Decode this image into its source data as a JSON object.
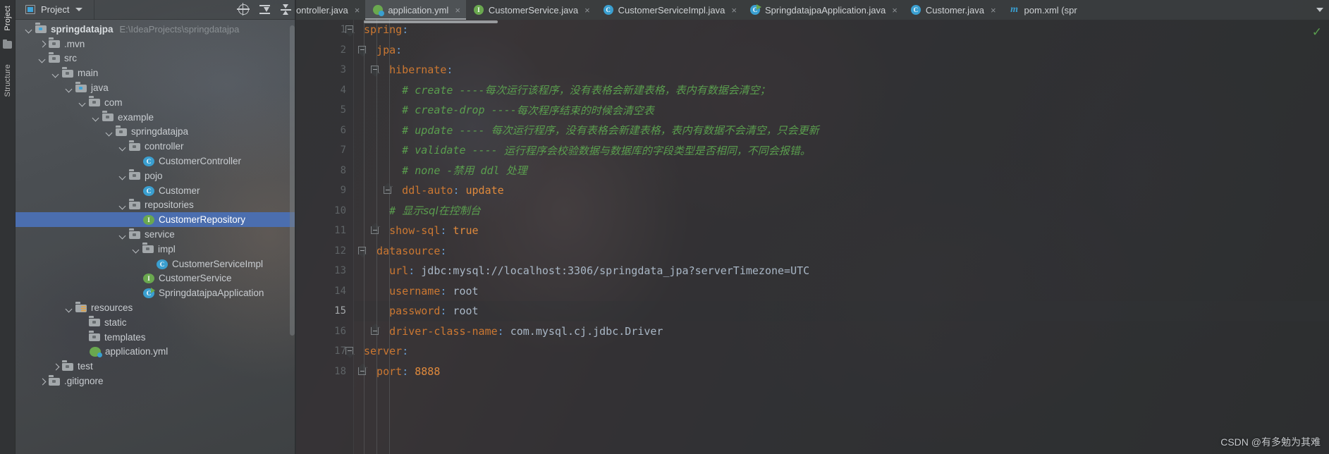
{
  "tool_strip": {
    "tabs": [
      {
        "label": "Project",
        "active": true
      },
      {
        "label": "Structure",
        "active": false
      }
    ],
    "folder_icon": "folder-icon"
  },
  "project_panel": {
    "header": {
      "icon": "project-view-icon",
      "title": "Project",
      "caret": "chevron-down-icon",
      "actions": [
        {
          "name": "locate-in-tree",
          "icon": "crosshair-icon"
        },
        {
          "name": "expand-all",
          "icon": "expand-all-icon"
        },
        {
          "name": "collapse-all",
          "icon": "collapse-all-icon"
        }
      ]
    },
    "tree": [
      {
        "indent": 0,
        "chevron": "down",
        "icon": "module-folder",
        "label": "springdatajpa",
        "bold": true,
        "path": "E:\\IdeaProjects\\springdatajpa",
        "selected": false
      },
      {
        "indent": 1,
        "chevron": "right",
        "icon": "folder",
        "label": ".mvn",
        "selected": false
      },
      {
        "indent": 1,
        "chevron": "down",
        "icon": "folder",
        "label": "src",
        "selected": false
      },
      {
        "indent": 2,
        "chevron": "down",
        "icon": "folder",
        "label": "main",
        "selected": false
      },
      {
        "indent": 3,
        "chevron": "down",
        "icon": "source-folder",
        "label": "java",
        "selected": false
      },
      {
        "indent": 4,
        "chevron": "down",
        "icon": "package",
        "label": "com",
        "selected": false
      },
      {
        "indent": 5,
        "chevron": "down",
        "icon": "package",
        "label": "example",
        "selected": false
      },
      {
        "indent": 6,
        "chevron": "down",
        "icon": "package",
        "label": "springdatajpa",
        "selected": false
      },
      {
        "indent": 7,
        "chevron": "down",
        "icon": "package",
        "label": "controller",
        "selected": false
      },
      {
        "indent": 8,
        "chevron": "none",
        "icon": "class",
        "label": "CustomerController",
        "selected": false
      },
      {
        "indent": 7,
        "chevron": "down",
        "icon": "package",
        "label": "pojo",
        "selected": false
      },
      {
        "indent": 8,
        "chevron": "none",
        "icon": "class",
        "label": "Customer",
        "selected": false
      },
      {
        "indent": 7,
        "chevron": "down",
        "icon": "package",
        "label": "repositories",
        "selected": false
      },
      {
        "indent": 8,
        "chevron": "none",
        "icon": "interface",
        "label": "CustomerRepository",
        "selected": true
      },
      {
        "indent": 7,
        "chevron": "down",
        "icon": "package",
        "label": "service",
        "selected": false
      },
      {
        "indent": 8,
        "chevron": "down",
        "icon": "package",
        "label": "impl",
        "selected": false
      },
      {
        "indent": 9,
        "chevron": "none",
        "icon": "class",
        "label": "CustomerServiceImpl",
        "selected": false
      },
      {
        "indent": 8,
        "chevron": "none",
        "icon": "interface",
        "label": "CustomerService",
        "selected": false
      },
      {
        "indent": 8,
        "chevron": "none",
        "icon": "spring-boot",
        "label": "SpringdatajpaApplication",
        "selected": false
      },
      {
        "indent": 3,
        "chevron": "down",
        "icon": "resource-folder",
        "label": "resources",
        "selected": false
      },
      {
        "indent": 4,
        "chevron": "none",
        "icon": "folder",
        "label": "static",
        "selected": false
      },
      {
        "indent": 4,
        "chevron": "none",
        "icon": "folder",
        "label": "templates",
        "selected": false
      },
      {
        "indent": 4,
        "chevron": "none",
        "icon": "yml-file",
        "label": "application.yml",
        "selected": false
      },
      {
        "indent": 2,
        "chevron": "right",
        "icon": "folder",
        "label": "test",
        "selected": false
      },
      {
        "indent": 1,
        "chevron": "right",
        "icon": "folder",
        "label": ".gitignore",
        "selected": false
      }
    ]
  },
  "editor": {
    "tabs": [
      {
        "label": "ontroller.java",
        "icon": "none",
        "active": false,
        "clipped": true,
        "close": "×"
      },
      {
        "label": "application.yml",
        "icon": "yml-file",
        "active": true,
        "clipped": false,
        "close": "×"
      },
      {
        "label": "CustomerService.java",
        "icon": "interface",
        "glyph": "I",
        "active": false,
        "clipped": false,
        "close": "×"
      },
      {
        "label": "CustomerServiceImpl.java",
        "icon": "class",
        "glyph": "C",
        "active": false,
        "clipped": false,
        "close": "×"
      },
      {
        "label": "SpringdatajpaApplication.java",
        "icon": "spring-boot",
        "active": false,
        "clipped": false,
        "close": "×"
      },
      {
        "label": "Customer.java",
        "icon": "class",
        "glyph": "C",
        "active": false,
        "clipped": false,
        "close": "×"
      },
      {
        "label": "pom.xml (spr",
        "icon": "maven",
        "glyph": "m",
        "active": false,
        "clipped": false,
        "close": ""
      }
    ],
    "tabbar_overflow_icon": "chevron-down-icon",
    "inspection_ok_icon": "✓",
    "lines": [
      {
        "n": 1,
        "fold": "open",
        "indent": 0,
        "segments": [
          {
            "t": "spring",
            "c": "k-key"
          },
          {
            "t": ":",
            "c": "k-punct"
          }
        ]
      },
      {
        "n": 2,
        "fold": "open",
        "indent": 1,
        "segments": [
          {
            "t": "  jpa",
            "c": "k-key"
          },
          {
            "t": ":",
            "c": "k-punct"
          }
        ]
      },
      {
        "n": 3,
        "fold": "open",
        "indent": 2,
        "segments": [
          {
            "t": "    hibernate",
            "c": "k-key"
          },
          {
            "t": ":",
            "c": "k-punct"
          }
        ]
      },
      {
        "n": 4,
        "fold": "none",
        "indent": 3,
        "segments": [
          {
            "t": "      # create ----",
            "c": "k-cmt"
          },
          {
            "t": "每次运行该程序，没有表格会新建表格，表内有数据会清空；",
            "c": "k-cmt-cn"
          }
        ]
      },
      {
        "n": 5,
        "fold": "none",
        "indent": 3,
        "segments": [
          {
            "t": "      # create-drop ----",
            "c": "k-cmt"
          },
          {
            "t": "每次程序结束的时候会清空表",
            "c": "k-cmt-cn"
          }
        ]
      },
      {
        "n": 6,
        "fold": "none",
        "indent": 3,
        "segments": [
          {
            "t": "      # update ---- ",
            "c": "k-cmt"
          },
          {
            "t": "每次运行程序，没有表格会新建表格，表内有数据不会清空，只会更新",
            "c": "k-cmt-cn"
          }
        ]
      },
      {
        "n": 7,
        "fold": "none",
        "indent": 3,
        "segments": [
          {
            "t": "      # validate ---- ",
            "c": "k-cmt"
          },
          {
            "t": "运行程序会校验数据与数据库的字段类型是否相同，不同会报错。",
            "c": "k-cmt-cn"
          }
        ]
      },
      {
        "n": 8,
        "fold": "none",
        "indent": 3,
        "segments": [
          {
            "t": "      # none -",
            "c": "k-cmt"
          },
          {
            "t": "禁用",
            "c": "k-cmt-cn"
          },
          {
            "t": " ddl ",
            "c": "k-cmt"
          },
          {
            "t": "处理",
            "c": "k-cmt-cn"
          }
        ]
      },
      {
        "n": 9,
        "fold": "close",
        "indent": 3,
        "segments": [
          {
            "t": "      ddl-auto",
            "c": "k-key"
          },
          {
            "t": ":",
            "c": "k-punct"
          },
          {
            "t": " update",
            "c": "k-val"
          }
        ]
      },
      {
        "n": 10,
        "fold": "none",
        "indent": 2,
        "segments": [
          {
            "t": "    # ",
            "c": "k-cmt"
          },
          {
            "t": "显示sql在控制台",
            "c": "k-cmt-cn"
          }
        ]
      },
      {
        "n": 11,
        "fold": "close",
        "indent": 2,
        "segments": [
          {
            "t": "    show-sql",
            "c": "k-key"
          },
          {
            "t": ":",
            "c": "k-punct"
          },
          {
            "t": " true",
            "c": "k-val"
          }
        ]
      },
      {
        "n": 12,
        "fold": "open",
        "indent": 1,
        "segments": [
          {
            "t": "  datasource",
            "c": "k-key"
          },
          {
            "t": ":",
            "c": "k-punct"
          }
        ]
      },
      {
        "n": 13,
        "fold": "none",
        "indent": 2,
        "segments": [
          {
            "t": "    url",
            "c": "k-key"
          },
          {
            "t": ":",
            "c": "k-punct"
          },
          {
            "t": " jdbc:mysql://localhost:3306/springdata_jpa?serverTimezone=UTC",
            "c": "k-str"
          }
        ]
      },
      {
        "n": 14,
        "fold": "none",
        "indent": 2,
        "segments": [
          {
            "t": "    username",
            "c": "k-key"
          },
          {
            "t": ":",
            "c": "k-punct"
          },
          {
            "t": " root",
            "c": "k-str"
          }
        ]
      },
      {
        "n": 15,
        "fold": "none",
        "indent": 2,
        "current": true,
        "segments": [
          {
            "t": "    password",
            "c": "k-key"
          },
          {
            "t": ":",
            "c": "k-punct"
          },
          {
            "t": " root",
            "c": "k-str"
          }
        ]
      },
      {
        "n": 16,
        "fold": "close",
        "indent": 2,
        "segments": [
          {
            "t": "    driver-class-name",
            "c": "k-key"
          },
          {
            "t": ":",
            "c": "k-punct"
          },
          {
            "t": " com.mysql.cj.jdbc.Driver",
            "c": "k-str"
          }
        ]
      },
      {
        "n": 17,
        "fold": "open",
        "indent": 0,
        "segments": [
          {
            "t": "server",
            "c": "k-key"
          },
          {
            "t": ":",
            "c": "k-punct"
          }
        ]
      },
      {
        "n": 18,
        "fold": "close",
        "indent": 1,
        "segments": [
          {
            "t": "  port",
            "c": "k-key"
          },
          {
            "t": ":",
            "c": "k-punct"
          },
          {
            "t": " 8888",
            "c": "k-val"
          }
        ]
      }
    ]
  },
  "watermark": "CSDN @有多勉为其难",
  "colors": {
    "selection": "#4b6eaf",
    "key": "#cc7832",
    "value": "#e08a3c",
    "string": "#a9b7c6",
    "comment": "#5a9e4e",
    "punct": "#6a9fd4"
  }
}
